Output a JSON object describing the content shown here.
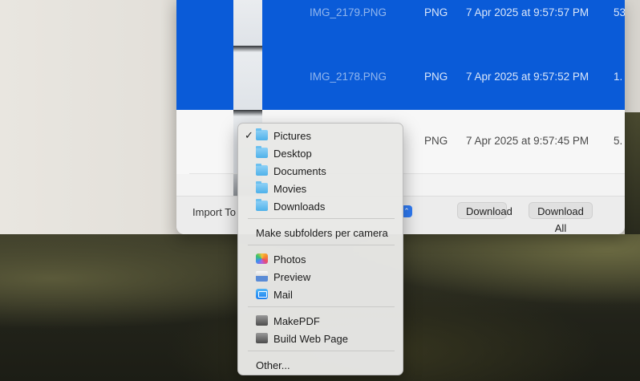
{
  "window": {
    "files": [
      {
        "name": "IMG_2179.PNG",
        "kind": "PNG",
        "date": "7 Apr 2025 at 9:57:57 PM",
        "size": "53",
        "selected": true
      },
      {
        "name": "IMG_2178.PNG",
        "kind": "PNG",
        "date": "7 Apr 2025 at 9:57:52 PM",
        "size": "1.",
        "selected": true
      },
      {
        "name": "",
        "kind": "PNG",
        "date": "7 Apr 2025 at 9:57:45 PM",
        "size": "5.",
        "selected": false
      }
    ],
    "import_label": "Import To",
    "download_label": "Download",
    "download_all_label": "Download All"
  },
  "menu": {
    "folders": [
      {
        "label": "Pictures",
        "checked": true,
        "icon": "folder-icon"
      },
      {
        "label": "Desktop",
        "checked": false,
        "icon": "folder-icon"
      },
      {
        "label": "Documents",
        "checked": false,
        "icon": "folder-icon"
      },
      {
        "label": "Movies",
        "checked": false,
        "icon": "folder-icon"
      },
      {
        "label": "Downloads",
        "checked": false,
        "icon": "downloads-folder-icon"
      }
    ],
    "check_mark": "✓",
    "subfolders_option": "Make subfolders per camera",
    "apps": [
      {
        "label": "Photos",
        "icon": "photos-app-icon"
      },
      {
        "label": "Preview",
        "icon": "preview-app-icon"
      },
      {
        "label": "Mail",
        "icon": "mail-app-icon"
      }
    ],
    "workflows": [
      {
        "label": "MakePDF",
        "icon": "automator-robot-icon"
      },
      {
        "label": "Build Web Page",
        "icon": "automator-robot-icon"
      }
    ],
    "other_option": "Other..."
  }
}
